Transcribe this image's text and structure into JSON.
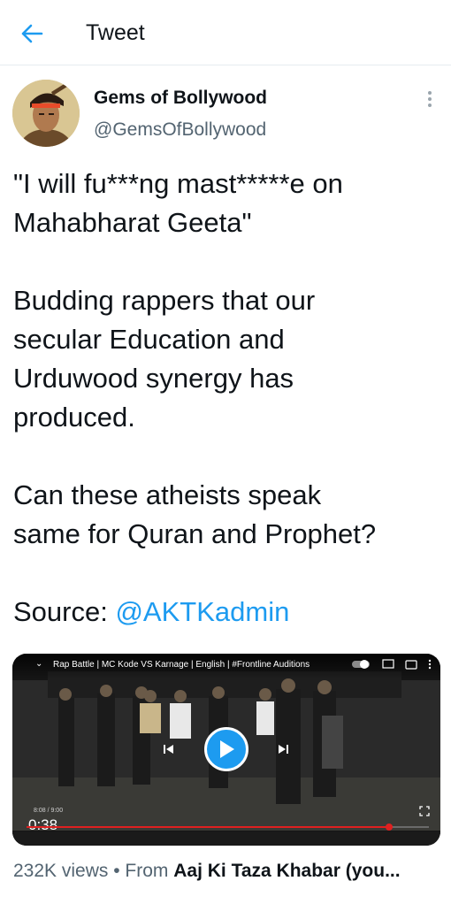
{
  "header": {
    "title": "Tweet",
    "back_icon": "arrow-left-icon",
    "accent_color": "#1d9bf0"
  },
  "author": {
    "name": "Gems of Bollywood",
    "handle": "@GemsOfBollywood",
    "more_icon": "more-vertical-icon"
  },
  "tweet": {
    "line1": "\"I will fu***ng mast*****e on",
    "line2": "Mahabharat Geeta\"",
    "para2_line1": "Budding rappers that our",
    "para2_line2": "secular Education and",
    "para2_line3": "Urduwood synergy has",
    "para2_line4": "produced.",
    "para3_line1": "Can these atheists speak",
    "para3_line2": "same for Quran and Prophet?",
    "source_label": "Source: ",
    "mention": "@AKTKadmin"
  },
  "video": {
    "title": "Rap Battle | MC Kode VS Karnage | English | #Frontline Auditions",
    "elapsed_small": "8:08 / 9:00",
    "duration": "0:38",
    "progress": 0.9,
    "play_icon": "play-icon",
    "prev_icon": "skip-previous-icon",
    "next_icon": "skip-next-icon",
    "fullscreen_icon": "fullscreen-icon",
    "cast_icon": "cast-icon",
    "cc_icon": "closed-captions-icon"
  },
  "meta": {
    "views": "232K views",
    "separator": " • ",
    "from_label": "From ",
    "source": "Aaj Ki Taza Khabar (you..."
  }
}
